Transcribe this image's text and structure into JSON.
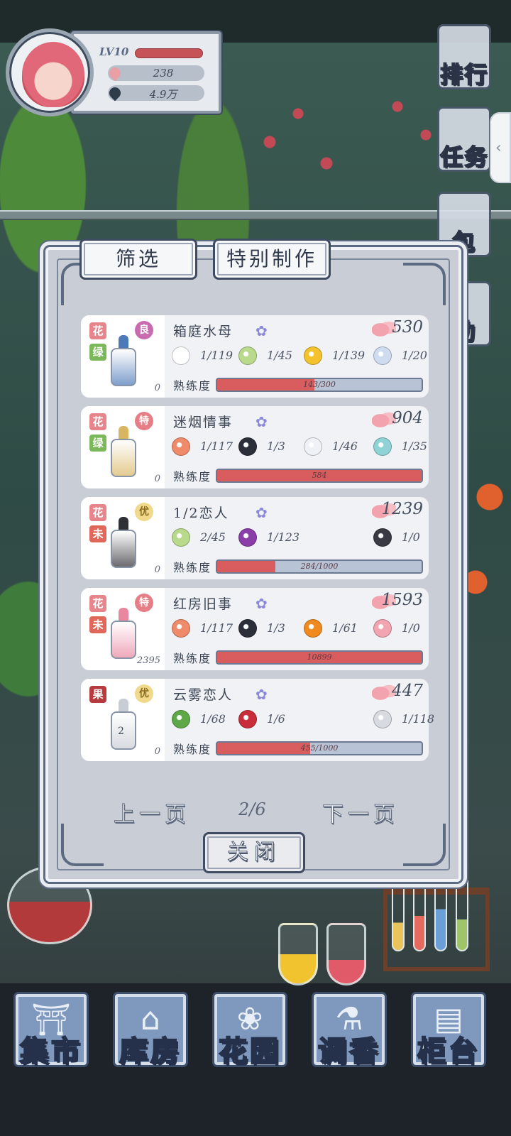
{
  "player": {
    "level": "LV10",
    "petals": "238",
    "leaves": "4.9万"
  },
  "side_menu": [
    {
      "label": "排行",
      "icon": "trophy-icon"
    },
    {
      "label": "任务",
      "icon": "scroll-icon"
    },
    {
      "label": "包",
      "icon": "gift-bag-icon"
    },
    {
      "label": "动",
      "icon": "cloud-icon"
    }
  ],
  "side_handle": "‹",
  "tabs": {
    "filter": "筛选",
    "special": "特别制作"
  },
  "recipes": [
    {
      "category": "花",
      "subtype": "绿",
      "quality": "良",
      "owned": "0",
      "name": "箱庭水母",
      "price": "530",
      "ingredients": [
        {
          "icon": "daisy-icon",
          "color": "#ffffff",
          "qty": "1/119"
        },
        {
          "icon": "green-rose-icon",
          "color": "#b9d98c",
          "qty": "1/45"
        },
        {
          "icon": "lemon-icon",
          "color": "#f3c22d",
          "qty": "1/139"
        },
        {
          "icon": "perfume-bottle-icon",
          "color": "#cfdcf0",
          "qty": "1/20"
        }
      ],
      "proficiency_label": "熟练度",
      "proficiency_text": "143/300",
      "proficiency": 0.477,
      "bottle_color": "#4d79b8"
    },
    {
      "category": "花",
      "subtype": "绿",
      "quality": "特",
      "owned": "0",
      "name": "迷烟情事",
      "price": "904",
      "ingredients": [
        {
          "icon": "orange-rose-icon",
          "color": "#ef8a6a",
          "qty": "1/117"
        },
        {
          "icon": "black-rose-icon",
          "color": "#2b2f3a",
          "qty": "1/3"
        },
        {
          "icon": "white-rose-icon",
          "color": "#eef2f7",
          "qty": "1/46"
        },
        {
          "icon": "perfume-bottle-icon",
          "color": "#8fd3d6",
          "qty": "1/35"
        }
      ],
      "proficiency_label": "熟练度",
      "proficiency_text": "584",
      "proficiency": 1,
      "bottle_color": "#d8b562"
    },
    {
      "category": "花",
      "subtype": "未",
      "quality": "优",
      "owned": "0",
      "name": "1/2恋人",
      "price": "1239",
      "ingredients": [
        {
          "icon": "green-rose-icon",
          "color": "#b9d98c",
          "qty": "2/45"
        },
        {
          "icon": "violet-icon",
          "color": "#8a3ea8",
          "qty": "1/123"
        },
        {
          "icon": "perfume-bottle-icon",
          "color": "#3a3a44",
          "qty": "1/0"
        }
      ],
      "proficiency_label": "熟练度",
      "proficiency_text": "284/1000",
      "proficiency": 0.284,
      "bottle_color": "#2f2f36"
    },
    {
      "category": "花",
      "subtype": "未",
      "quality": "特",
      "owned": "2395",
      "name": "红房旧事",
      "price": "1593",
      "ingredients": [
        {
          "icon": "orange-rose-icon",
          "color": "#ef8a6a",
          "qty": "1/117"
        },
        {
          "icon": "black-rose-icon",
          "color": "#2b2f3a",
          "qty": "1/3"
        },
        {
          "icon": "kumquat-icon",
          "color": "#f08a1e",
          "qty": "1/61"
        },
        {
          "icon": "perfume-bottle-icon",
          "color": "#f2a4b0",
          "qty": "1/0"
        }
      ],
      "proficiency_label": "熟练度",
      "proficiency_text": "10899",
      "proficiency": 1,
      "bottle_color": "#e986a0"
    },
    {
      "category": "果",
      "subtype": "",
      "quality": "优",
      "owned": "0",
      "name": "云雾恋人",
      "price": "447",
      "ingredients": [
        {
          "icon": "mint-leaf-icon",
          "color": "#5fa848",
          "qty": "1/68"
        },
        {
          "icon": "lychee-icon",
          "color": "#c92d3a",
          "qty": "1/6"
        },
        {
          "icon": "perfume-bottle-icon",
          "color": "#d7dbe1",
          "qty": "1/118"
        }
      ],
      "proficiency_label": "熟练度",
      "proficiency_text": "455/1000",
      "proficiency": 0.455,
      "bottle_color": "#c8ccd4",
      "bottle_label": "2"
    }
  ],
  "pagination": {
    "prev": "上一页",
    "page": "2/6",
    "next": "下一页"
  },
  "close_label": "关闭",
  "bottom_nav": [
    {
      "label": "集市",
      "icon": "market-gate-icon"
    },
    {
      "label": "库房",
      "icon": "warehouse-icon"
    },
    {
      "label": "花园",
      "icon": "rose-icon"
    },
    {
      "label": "调香",
      "icon": "dropper-icon"
    },
    {
      "label": "柜台",
      "icon": "counter-icon"
    }
  ],
  "colors": {
    "price_petal": "#f2a3ad",
    "proficiency_fill": "#d95c5e",
    "proficiency_track": "#b8c3d5",
    "flower_badge": "#8c88d8"
  }
}
